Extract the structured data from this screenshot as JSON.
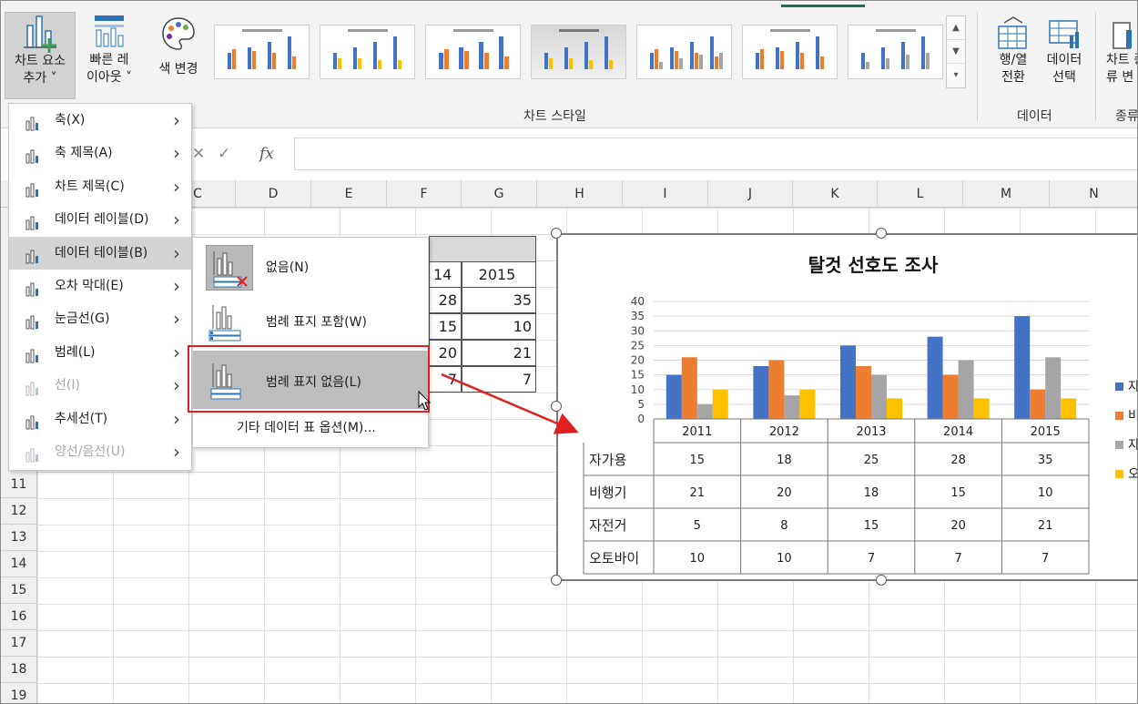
{
  "ribbon": {
    "add_element_line1": "차트 요소",
    "add_element_line2": "추가 ˅",
    "quick_layout_line1": "빠른 레",
    "quick_layout_line2": "이아웃 ˅",
    "change_color": "색 변경",
    "chart_styles_label": "차트 스타일",
    "switch_row_col_line1": "행/열",
    "switch_row_col_line2": "전환",
    "select_data_line1": "데이터",
    "select_data_line2": "선택",
    "data_group_label": "데이터",
    "change_type_line1": "차트 종",
    "change_type_line2": "류 변",
    "type_group_label": "종류"
  },
  "formula_bar": {
    "cancel": "✕",
    "enter": "✓",
    "fx": "fx"
  },
  "columns": [
    "C",
    "D",
    "E",
    "F",
    "G",
    "H",
    "I",
    "J",
    "K",
    "L",
    "M",
    "N"
  ],
  "rows": [
    "11",
    "12",
    "13",
    "14",
    "15",
    "16",
    "17",
    "18",
    "19"
  ],
  "sheet_table": {
    "headers": [
      "14",
      "2015"
    ],
    "values": [
      [
        "28",
        "35"
      ],
      [
        "15",
        "10"
      ],
      [
        "20",
        "21"
      ],
      [
        "7",
        "7"
      ]
    ]
  },
  "menu": {
    "items": [
      {
        "label": "축(X)",
        "icon": "axes-icon"
      },
      {
        "label": "축 제목(A)",
        "icon": "axis-title-icon"
      },
      {
        "label": "차트 제목(C)",
        "icon": "chart-title-icon"
      },
      {
        "label": "데이터 레이블(D)",
        "icon": "data-labels-icon"
      },
      {
        "label": "데이터 테이블(B)",
        "icon": "data-table-icon"
      },
      {
        "label": "오차 막대(E)",
        "icon": "error-bars-icon"
      },
      {
        "label": "눈금선(G)",
        "icon": "gridlines-icon"
      },
      {
        "label": "범례(L)",
        "icon": "legend-icon"
      },
      {
        "label": "선(I)",
        "icon": "lines-icon"
      },
      {
        "label": "추세선(T)",
        "icon": "trendline-icon"
      },
      {
        "label": "양선/음선(U)",
        "icon": "updown-bars-icon"
      }
    ]
  },
  "submenu": {
    "none": "없음(N)",
    "with_legend": "범례 표지 포함(W)",
    "no_legend": "범례 표지 없음(L)",
    "more": "기타 데이터 표 옵션(M)..."
  },
  "chart_data": {
    "type": "bar",
    "title": "탈것 선호도 조사",
    "categories": [
      "2011",
      "2012",
      "2013",
      "2014",
      "2015"
    ],
    "series": [
      {
        "name": "자가용",
        "values": [
          15,
          18,
          25,
          28,
          35
        ],
        "color": "#4472C4"
      },
      {
        "name": "비행기",
        "values": [
          21,
          20,
          18,
          15,
          10
        ],
        "color": "#ED7D31"
      },
      {
        "name": "자전거",
        "values": [
          5,
          8,
          15,
          20,
          21
        ],
        "color": "#A5A5A5"
      },
      {
        "name": "오토바이",
        "values": [
          10,
          10,
          7,
          7,
          7
        ],
        "color": "#FFC000"
      }
    ],
    "ylim": [
      0,
      40
    ],
    "yticks": [
      "0",
      "5",
      "10",
      "15",
      "20",
      "25",
      "30",
      "35",
      "40"
    ],
    "legend_labels": [
      "자",
      "비",
      "자",
      "오"
    ],
    "grid": true,
    "legend": "right"
  }
}
